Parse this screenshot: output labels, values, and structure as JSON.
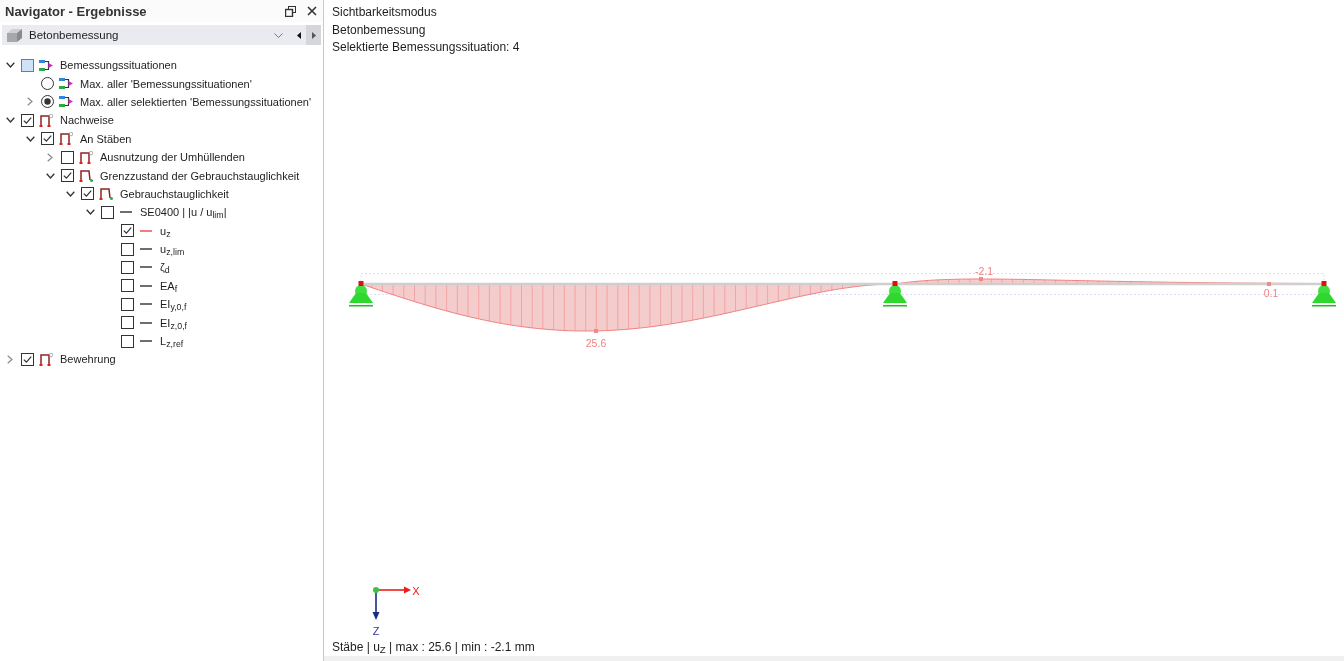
{
  "navigator": {
    "title": "Navigator - Ergebnisse",
    "module": "Betonbemessung",
    "tree": [
      {
        "label": "Bemessungssituationen",
        "kind": "situations",
        "expanded": true,
        "checked": false,
        "indeterminate": true,
        "children": [
          {
            "label": "Max. aller 'Bemessungssituationen'",
            "kind": "radio",
            "selected": false
          },
          {
            "label": "Max. aller selektierten 'Bemessungssituationen'",
            "kind": "radio",
            "selected": true,
            "expanded": false
          }
        ]
      },
      {
        "label": "Nachweise",
        "kind": "design-check",
        "expanded": true,
        "checked": true,
        "indeterminate": false,
        "children": [
          {
            "label": "An Stäben",
            "kind": "design-check",
            "expanded": true,
            "checked": true,
            "children": [
              {
                "label": "Ausnutzung der Umhüllenden",
                "kind": "design-check",
                "expanded": false,
                "checked": false
              },
              {
                "label": "Grenzzustand der Gebrauchstauglichkeit",
                "kind": "serviceability",
                "expanded": true,
                "checked": true,
                "children": [
                  {
                    "label": "Gebrauchstauglichkeit",
                    "kind": "serviceability",
                    "expanded": true,
                    "checked": true,
                    "children": [
                      {
                        "label": "SE0400 | |u / u$_{lim}$|",
                        "kind": "result",
                        "expanded": true,
                        "checked": false,
                        "color": "#6e6e6e",
                        "children": [
                          {
                            "label": "u$_{z}$",
                            "kind": "result",
                            "checked": true,
                            "color": "#f47c7c"
                          },
                          {
                            "label": "u$_{z,lim}$",
                            "kind": "result",
                            "checked": false,
                            "color": "#6e6e6e"
                          },
                          {
                            "label": "ζ$_{d}$",
                            "kind": "result",
                            "checked": false,
                            "color": "#6e6e6e"
                          },
                          {
                            "label": "EA$_{f}$",
                            "kind": "result",
                            "checked": false,
                            "color": "#6e6e6e"
                          },
                          {
                            "label": "EI$_{y,0,f}$",
                            "kind": "result",
                            "checked": false,
                            "color": "#6e6e6e"
                          },
                          {
                            "label": "EI$_{z,0,f}$",
                            "kind": "result",
                            "checked": false,
                            "color": "#6e6e6e"
                          },
                          {
                            "label": "L$_{z,ref}$",
                            "kind": "result",
                            "checked": false,
                            "color": "#6e6e6e"
                          }
                        ]
                      }
                    ]
                  }
                ]
              }
            ]
          }
        ]
      },
      {
        "label": "Bewehrung",
        "kind": "design-check",
        "expanded": false,
        "checked": true,
        "indeterminate": false
      }
    ]
  },
  "view": {
    "info_lines": [
      "Sichtbarkeitsmodus",
      "Betonbemessung",
      "Selektierte Bemessungssituation: 4"
    ],
    "value_labels": [
      "25.6",
      "-2.1",
      "0.1"
    ],
    "axes": {
      "x": "X",
      "z": "Z"
    },
    "status": "Stäbe | u$_{Z}$ | max : 25.6 | min : -2.1 mm"
  }
}
